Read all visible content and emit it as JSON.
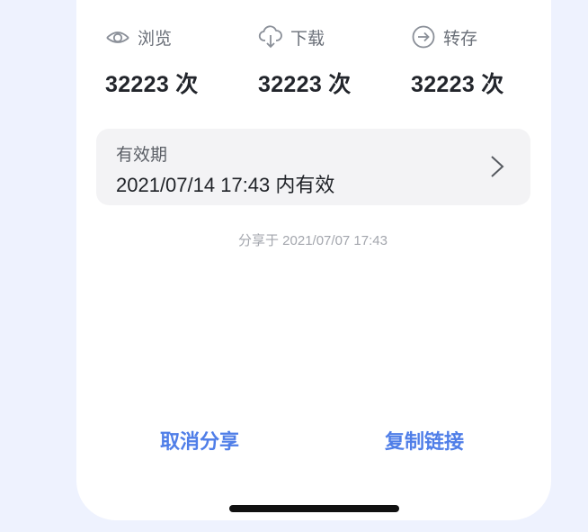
{
  "stats": [
    {
      "icon": "eye-icon",
      "label": "浏览",
      "value": "32223 次"
    },
    {
      "icon": "cloud-download-icon",
      "label": "下载",
      "value": "32223 次"
    },
    {
      "icon": "circle-arrow-right-icon",
      "label": "转存",
      "value": "32223 次"
    }
  ],
  "validity": {
    "label": "有效期",
    "value": "2021/07/14 17:43 内有效"
  },
  "share_time": "分享于 2021/07/07 17:43",
  "actions": {
    "cancel_label": "取消分享",
    "copy_label": "复制链接"
  },
  "colors": {
    "accent": "#4f7ee8",
    "background": "#eef2fe",
    "card": "#ffffff"
  }
}
